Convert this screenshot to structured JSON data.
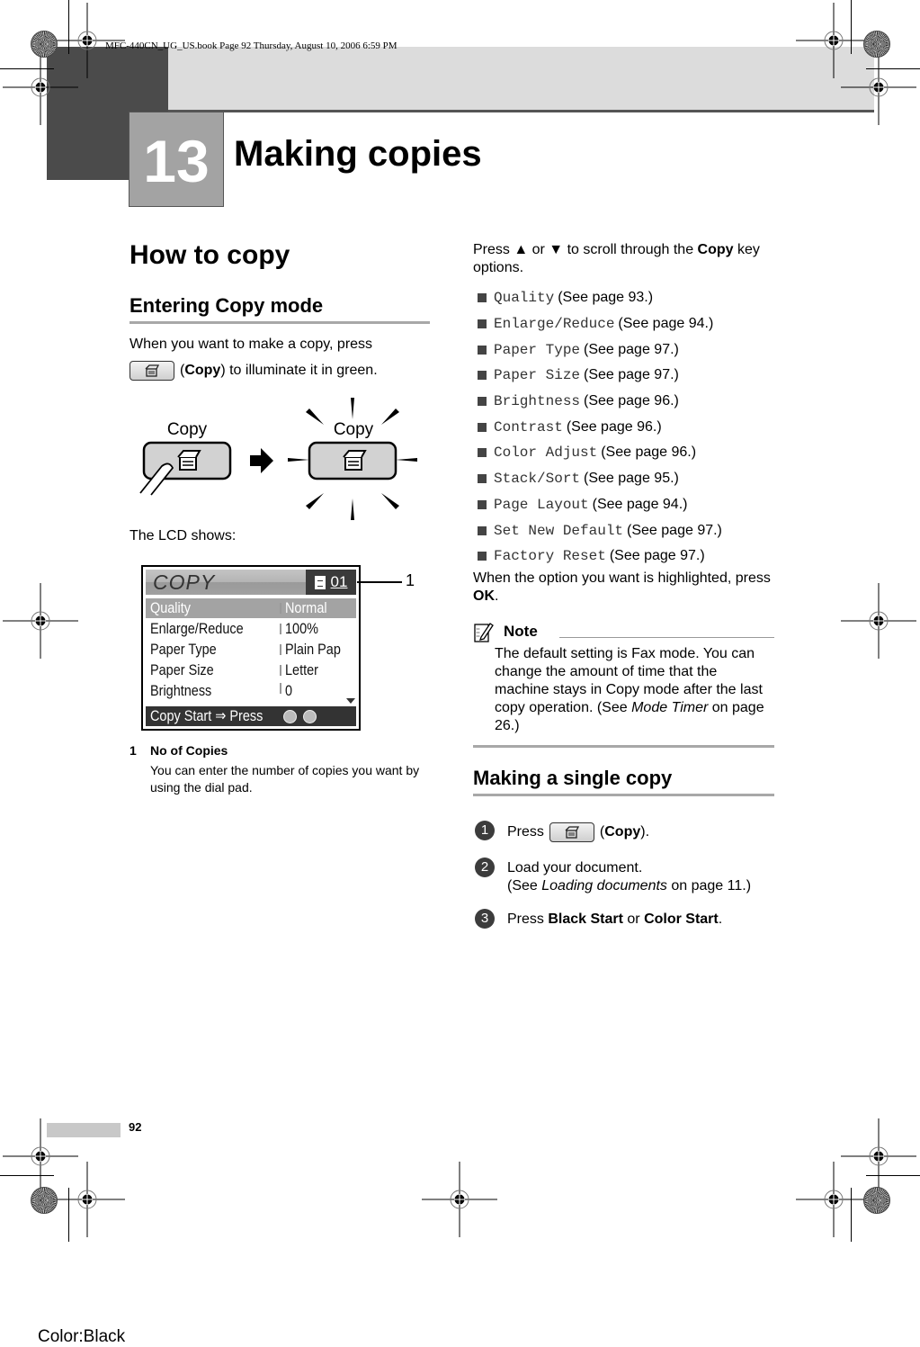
{
  "header": {
    "book_info": "MFC-440CN_UG_US.book  Page 92  Thursday, August 10, 2006  6:59 PM",
    "chapter_number": "13",
    "chapter_title": "Making copies"
  },
  "left_column": {
    "heading": "How to copy",
    "subheading": "Entering Copy mode",
    "intro_line1": "When you want to make a copy, press",
    "intro_line2_pre": "(",
    "intro_line2_bold": "Copy",
    "intro_line2_post": ") to illuminate it in green.",
    "illustration": {
      "left_label": "Copy",
      "right_label": "Copy"
    },
    "lcd_intro": "The LCD shows:",
    "lcd": {
      "title": "COPY",
      "copy_count": "01",
      "rows": [
        {
          "label": "Quality",
          "value": "Normal",
          "highlighted": true
        },
        {
          "label": "Enlarge/Reduce",
          "value": "100%"
        },
        {
          "label": "Paper Type",
          "value": "Plain Pap"
        },
        {
          "label": "Paper Size",
          "value": "Letter"
        },
        {
          "label": "Brightness",
          "value": " 0"
        }
      ],
      "footer": "Copy Start  ⇒ Press"
    },
    "callout_number": "1",
    "legend": {
      "number": "1",
      "title": "No of Copies",
      "description": "You can enter the number of copies you want by using the dial pad."
    }
  },
  "right_column": {
    "scroll_pre": "Press ▲ or ▼ to scroll through the ",
    "scroll_bold": "Copy",
    "scroll_post": " key options.",
    "options": [
      {
        "name": "Quality",
        "ref": "(See page 93.)"
      },
      {
        "name": "Enlarge/Reduce",
        "ref": "(See page 94.)"
      },
      {
        "name": "Paper Type",
        "ref": "(See page 97.)"
      },
      {
        "name": "Paper Size",
        "ref": "(See page 97.)"
      },
      {
        "name": "Brightness",
        "ref": "(See page 96.)"
      },
      {
        "name": "Contrast",
        "ref": "(See page 96.)"
      },
      {
        "name": "Color Adjust",
        "ref": "(See page 96.)"
      },
      {
        "name": "Stack/Sort",
        "ref": "(See page 95.)"
      },
      {
        "name": "Page Layout",
        "ref": "(See page 94.)"
      },
      {
        "name": "Set New Default",
        "ref": "(See page 97.)"
      },
      {
        "name": "Factory Reset",
        "ref": "(See page 97.)"
      }
    ],
    "highlighted_pre": "When the option you want is highlighted, press ",
    "highlighted_bold": "OK",
    "highlighted_post": ".",
    "note": {
      "title": "Note",
      "text_pre": "The default setting is Fax mode. You can change the amount of time that the machine stays in Copy mode after the last copy operation. (See ",
      "text_italic": "Mode Timer",
      "text_post": " on page 26.)"
    },
    "single_copy": {
      "heading": "Making a single copy",
      "steps": [
        {
          "number": "1",
          "pre": "Press",
          "bold": "Copy",
          "post": ")."
        },
        {
          "number": "2",
          "line1": "Load your document.",
          "line2_pre": "(See ",
          "line2_italic": "Loading documents",
          "line2_post": " on page 11.)"
        },
        {
          "number": "3",
          "pre": "Press ",
          "bold1": "Black Start",
          "mid": " or ",
          "bold2": "Color Start",
          "post": "."
        }
      ]
    }
  },
  "footer": {
    "page_number": "92",
    "color_label": "Color:Black"
  }
}
